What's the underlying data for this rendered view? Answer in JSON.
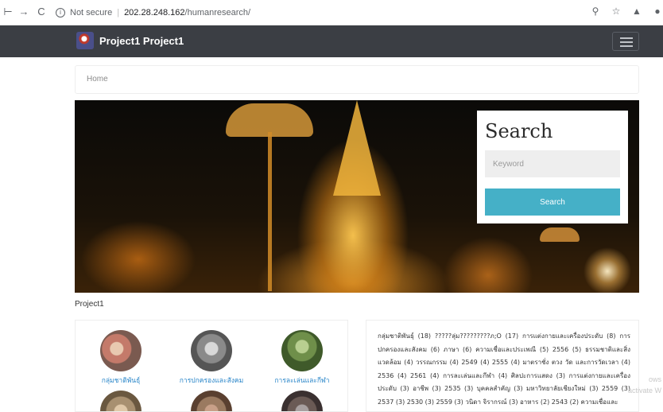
{
  "browser": {
    "security_label": "Not secure",
    "url_host": "202.28.248.162",
    "url_path": "/humanresearch/"
  },
  "navbar": {
    "brand": "Project1 Project1"
  },
  "breadcrumb": {
    "home": "Home"
  },
  "search": {
    "title": "Search",
    "placeholder": "Keyword",
    "button_label": "Search"
  },
  "section": {
    "label": "Project1"
  },
  "categories": [
    {
      "label": "กลุ่มชาติพันธุ์",
      "color": "#c47a6a"
    },
    {
      "label": "การปกครองและสังคม",
      "color": "#8a8a8a"
    },
    {
      "label": "การละเล่นและกีฬา",
      "color": "#6f8f4a"
    },
    {
      "label": "",
      "color": "#a89070"
    },
    {
      "label": "",
      "color": "#9a7a60"
    },
    {
      "label": "",
      "color": "#6a5a55"
    }
  ],
  "tag_cloud": "กลุ่มชาติพันธุ์ (18) ?????ลุ่ม?????????ภ;O (17) การแต่งกายและเครื่องประดับ (8) การปกครองและสังคม (6) ภาษา (6) ความเชื่อและประเพณี (5) 2556 (5) ธรรมชาติและสิ่งแวดล้อม (4) วรรณกรรม (4) 2549 (4) 2555 (4) มาตราชั่ง ตวง วัด และการวัดเวลา (4) 2536 (4) 2561 (4) การละเล่นและกีฬา (4) ศิลปะการแสดง (3) การแต่งกายและเครื่องประดับ (3) อาชีพ (3) 2535 (3) บุคคลสำคัญ (3) มหาวิทยาลัยเชียงใหม่ (3) 2559 (3) 2537 (3) 2530 (3) 2559 (3) วนิดา จิรากรณ์ (3) อาหาร (2) 2543 (2) ความเชื่อและ",
  "watermark": {
    "line1": "ows",
    "line2": "activate W"
  },
  "colors": {
    "navbar": "#3b3e44",
    "accent": "#45b0c7",
    "link": "#2a86c9"
  }
}
